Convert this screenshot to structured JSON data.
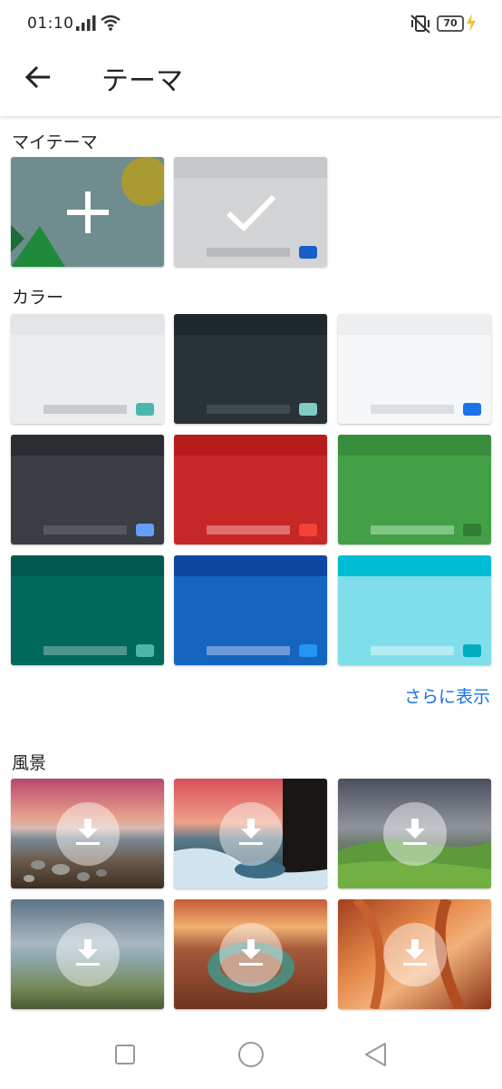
{
  "status_bar": {
    "time": "01:10",
    "battery": "70",
    "icons": [
      "signal-icon",
      "wifi-icon",
      "vibrate-off-icon",
      "battery-icon",
      "charging-icon"
    ]
  },
  "app_bar": {
    "title": "テーマ",
    "back_icon": "arrow-back-icon"
  },
  "my_themes": {
    "label": "マイテーマ",
    "items": [
      {
        "name": "add-custom-theme",
        "icon": "plus-icon"
      },
      {
        "name": "selected-default-theme",
        "icon": "check-icon"
      }
    ]
  },
  "colors": {
    "label": "カラー",
    "more_link": "さらに表示",
    "tiles": [
      {
        "name": "light-gray",
        "body": "#ebedef",
        "top": "#e3e5e8",
        "bar": "#c9cbce",
        "key": "#4db6ac"
      },
      {
        "name": "dark",
        "body": "#283237",
        "top": "#1f282c",
        "bar": "#404a4f",
        "key": "#80cbc4"
      },
      {
        "name": "white",
        "body": "#f6f7f8",
        "top": "#eceef0",
        "bar": "#dcdee1",
        "key": "#1a73e8"
      },
      {
        "name": "dark-gray",
        "body": "#3a3d41",
        "top": "#2a2d31",
        "bar": "#55585c",
        "key": "#669df6"
      },
      {
        "name": "red",
        "body": "#c62828",
        "top": "#b71c1c",
        "bar": "#dd6e6e",
        "key": "#f44336"
      },
      {
        "name": "green",
        "body": "#43a047",
        "top": "#388e3c",
        "bar": "#81c784",
        "key": "#2e7d32"
      },
      {
        "name": "teal",
        "body": "#00695c",
        "top": "#005a52",
        "bar": "#4d968d",
        "key": "#4db6ac"
      },
      {
        "name": "blue",
        "body": "#1565c0",
        "top": "#0d47a1",
        "bar": "#6a9bd8",
        "key": "#2196f3"
      },
      {
        "name": "cyan",
        "body": "#80deea",
        "top": "#00bcd4",
        "bar": "#b2ebf2",
        "key": "#00acc1"
      }
    ]
  },
  "landscapes": {
    "label": "風景",
    "items": [
      {
        "name": "beach-sunset",
        "download_icon": "download-icon"
      },
      {
        "name": "frozen-waterfall",
        "download_icon": "download-icon"
      },
      {
        "name": "green-hills",
        "download_icon": "download-icon"
      },
      {
        "name": "calm-shore",
        "download_icon": "download-icon"
      },
      {
        "name": "horseshoe-canyon",
        "download_icon": "download-icon"
      },
      {
        "name": "antelope-canyon",
        "download_icon": "download-icon"
      }
    ]
  },
  "nav_bar": {
    "icons": [
      "recents-square-icon",
      "home-circle-icon",
      "back-triangle-icon"
    ]
  }
}
